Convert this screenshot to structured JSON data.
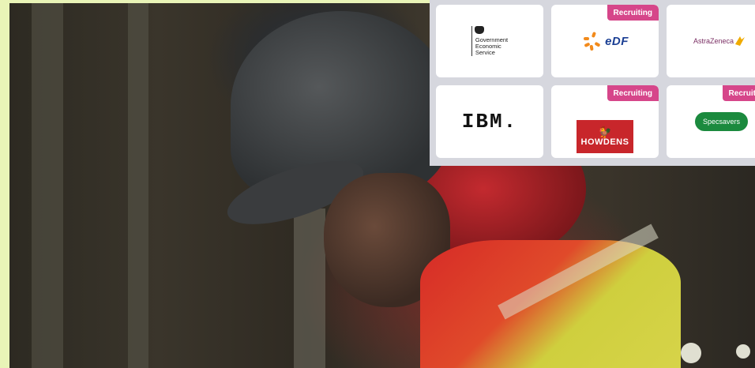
{
  "hero": {
    "image_alt": "Warehouse worker wearing cap and high-visibility vest"
  },
  "employers": [
    {
      "name": "Government Economic Service",
      "logo_lines": [
        "Government",
        "Economic",
        "Service"
      ],
      "badge": ""
    },
    {
      "name": "EDF",
      "logo_text": "eDF",
      "badge": "Recruiting"
    },
    {
      "name": "AstraZeneca",
      "logo_text": "AstraZeneca",
      "badge": ""
    },
    {
      "name": "IBM",
      "logo_text": "IBM.",
      "badge": ""
    },
    {
      "name": "Howdens",
      "logo_text": "HOWDENS",
      "badge": "Recruiting"
    },
    {
      "name": "Specsavers",
      "logo_text": "Specsavers",
      "badge": "Recruiting"
    }
  ],
  "colors": {
    "badge": "#d6468a",
    "page_bg": "#e9f4b7",
    "panel_bg": "#d6d7de"
  }
}
